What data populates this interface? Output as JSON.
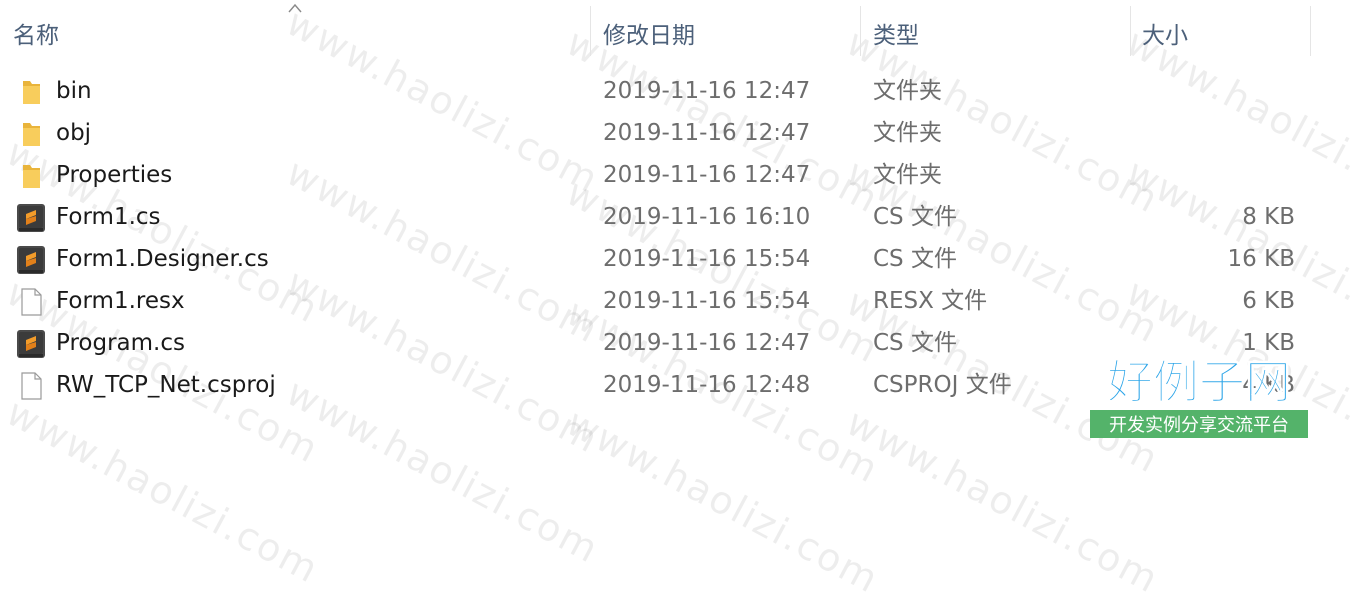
{
  "headers": {
    "name": "名称",
    "date_modified": "修改日期",
    "type": "类型",
    "size": "大小"
  },
  "files": [
    {
      "icon": "folder-icon",
      "name": "bin",
      "date": "2019-11-16 12:47",
      "type": "文件夹",
      "size": ""
    },
    {
      "icon": "folder-icon",
      "name": "obj",
      "date": "2019-11-16 12:47",
      "type": "文件夹",
      "size": ""
    },
    {
      "icon": "folder-icon",
      "name": "Properties",
      "date": "2019-11-16 12:47",
      "type": "文件夹",
      "size": ""
    },
    {
      "icon": "sublime-file-icon",
      "name": "Form1.cs",
      "date": "2019-11-16 16:10",
      "type": "CS 文件",
      "size": "8 KB"
    },
    {
      "icon": "sublime-file-icon",
      "name": "Form1.Designer.cs",
      "date": "2019-11-16 15:54",
      "type": "CS 文件",
      "size": "16 KB"
    },
    {
      "icon": "blank-file-icon",
      "name": "Form1.resx",
      "date": "2019-11-16 15:54",
      "type": "RESX 文件",
      "size": "6 KB"
    },
    {
      "icon": "sublime-file-icon",
      "name": "Program.cs",
      "date": "2019-11-16 12:47",
      "type": "CS 文件",
      "size": "1 KB"
    },
    {
      "icon": "blank-file-icon",
      "name": "RW_TCP_Net.csproj",
      "date": "2019-11-16 12:48",
      "type": "CSPROJ 文件",
      "size": "4 KB"
    }
  ],
  "watermark": {
    "text": "www.haolizi.com"
  },
  "logo": {
    "title": "好例子网",
    "tagline": "开发实例分享交流平台",
    "title_color": "#2aa4e8",
    "tagline_bg": "#54b36a"
  },
  "colors": {
    "folder": "#f5c453",
    "header_text": "#4c607a",
    "muted_text": "#6d6d6d"
  }
}
